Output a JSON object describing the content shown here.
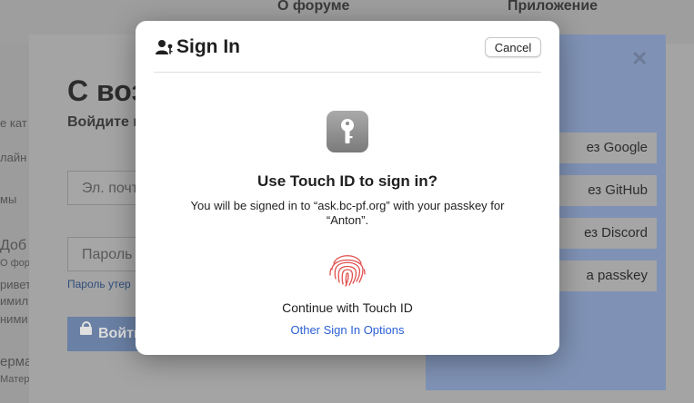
{
  "background": {
    "nav": {
      "link1": "О форуме",
      "link2": "Приложение"
    },
    "strip": [
      "е кат",
      "лайн",
      "мы",
      "Доб",
      "О форуме",
      "ривет",
      "имил",
      "ними",
      "ерма",
      "Матер"
    ],
    "login_modal": {
      "heading": "С воз",
      "subheading": "Войдите в",
      "email_placeholder": "Эл. почт",
      "password_placeholder": "Пароль",
      "forgot_link": "Пароль утер",
      "submit_label": "Войти",
      "close_symbol": "✕",
      "oauth": [
        "ез Google",
        "ез GitHub",
        "ез Discord",
        "а passkey"
      ]
    }
  },
  "sheet": {
    "header_icon": "person-key-icon",
    "title": "Sign In",
    "cancel_label": "Cancel",
    "app_icon": "key-icon",
    "prompt_title": "Use Touch ID to sign in?",
    "prompt_description": "You will be signed in to “ask.bc-pf.org” with your passkey for “Anton”.",
    "fingerprint_icon": "fingerprint-icon",
    "continue_label": "Continue with Touch ID",
    "other_options_label": "Other Sign In Options",
    "accent_color": "#2a5fd6"
  }
}
